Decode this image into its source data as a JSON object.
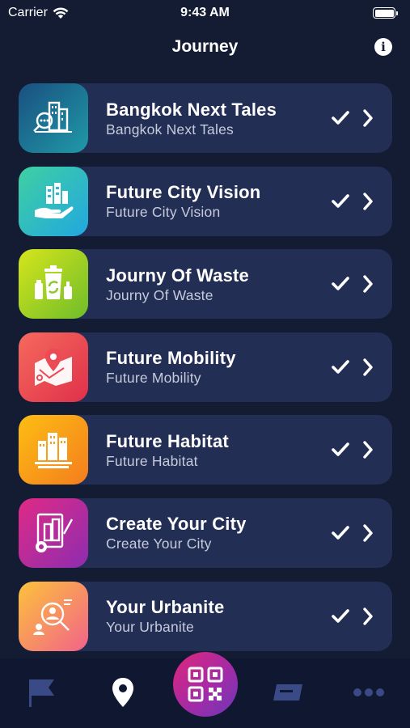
{
  "status_bar": {
    "carrier": "Carrier",
    "time": "9:43 AM",
    "icons": [
      "wifi-icon",
      "battery-icon"
    ]
  },
  "header": {
    "title": "Journey",
    "info_icon": "info-icon"
  },
  "items": [
    {
      "title": "Bangkok Next Tales",
      "subtitle": "Bangkok Next Tales",
      "icon": "city-search-icon",
      "colors": [
        "#1a4f80",
        "#1f9aa8"
      ],
      "completed": true
    },
    {
      "title": "Future City Vision",
      "subtitle": "Future City Vision",
      "icon": "hand-city-icon",
      "colors": [
        "#3fd0a2",
        "#22a7e0"
      ],
      "completed": true
    },
    {
      "title": "Journy Of Waste",
      "subtitle": "Journy Of Waste",
      "icon": "recycle-bin-icon",
      "colors": [
        "#d6e51c",
        "#6fbd2a"
      ],
      "completed": true
    },
    {
      "title": "Future Mobility",
      "subtitle": "Future Mobility",
      "icon": "map-pin-icon",
      "colors": [
        "#f56a5d",
        "#e0304a"
      ],
      "completed": true
    },
    {
      "title": "Future Habitat",
      "subtitle": "Future Habitat",
      "icon": "buildings-icon",
      "colors": [
        "#fdbe12",
        "#f47d1e"
      ],
      "completed": true
    },
    {
      "title": "Create Your City",
      "subtitle": "Create Your City",
      "icon": "city-design-icon",
      "colors": [
        "#e02a86",
        "#8d2db0"
      ],
      "completed": true
    },
    {
      "title": "Your Urbanite",
      "subtitle": "Your Urbanite",
      "icon": "profile-search-icon",
      "colors": [
        "#fcc23b",
        "#f2638a"
      ],
      "completed": true
    }
  ],
  "tab_bar": {
    "tabs": [
      "flag-icon",
      "location-pin-icon",
      "qr-code-icon",
      "ticket-icon",
      "more-icon"
    ],
    "active_tab": "location-pin-icon",
    "qr_colors": [
      "#e0267a",
      "#6b38b8"
    ]
  }
}
